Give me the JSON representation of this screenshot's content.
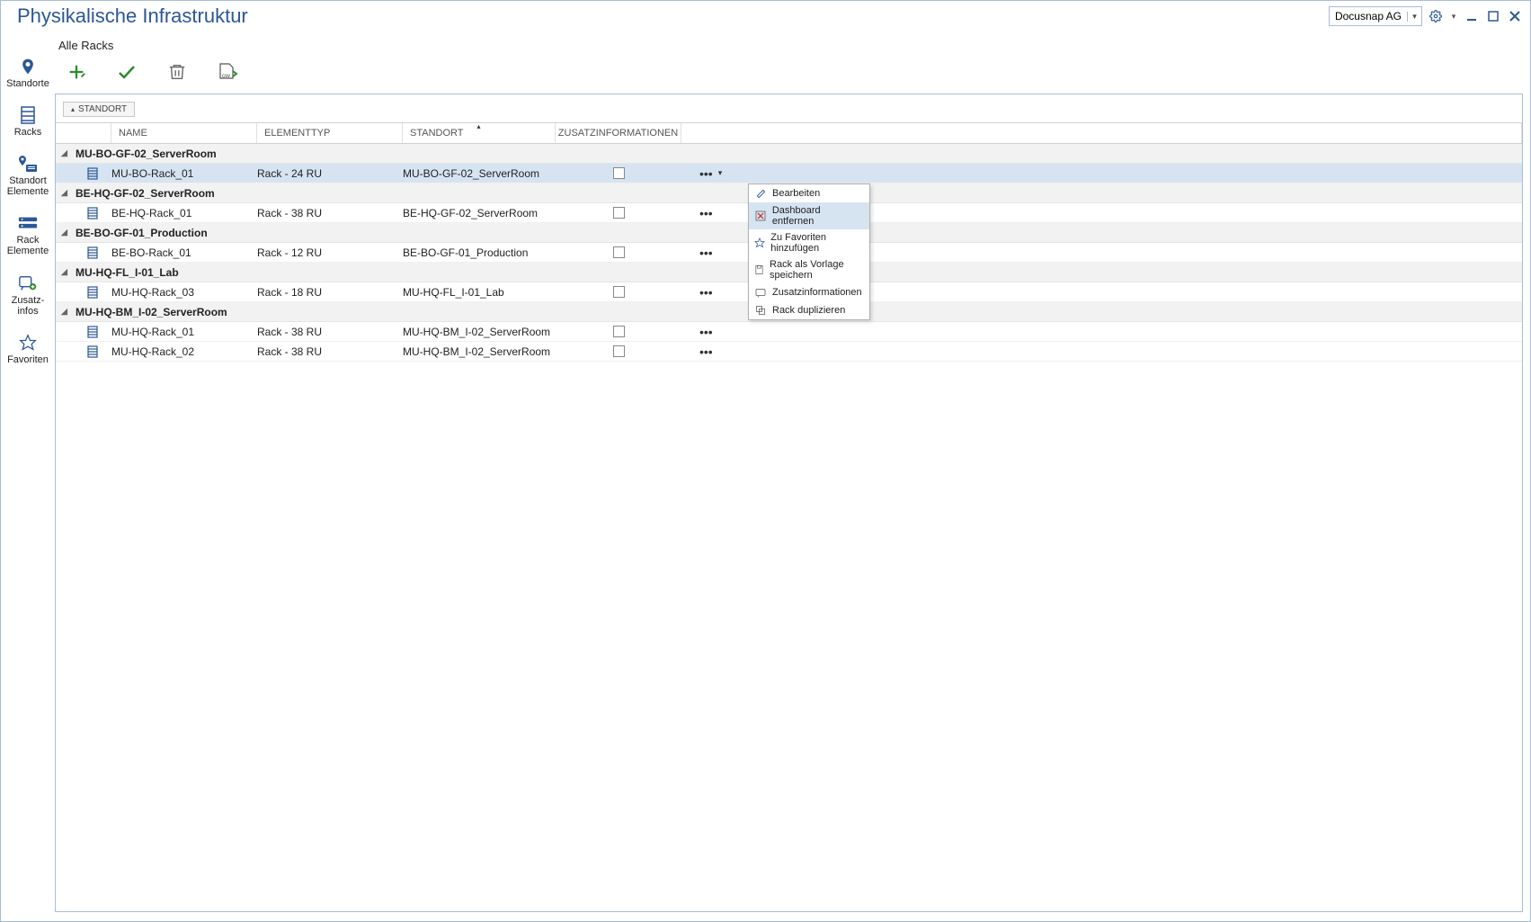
{
  "app_title": "Physikalische Infrastruktur",
  "org_name": "Docusnap AG",
  "sidebar": [
    {
      "id": "standorte",
      "label": "Standorte"
    },
    {
      "id": "racks",
      "label": "Racks"
    },
    {
      "id": "standort-elemente",
      "label": "Standort\nElemente"
    },
    {
      "id": "rack-elemente",
      "label": "Rack\nElemente"
    },
    {
      "id": "zusatz-infos",
      "label": "Zusatz-\ninfos"
    },
    {
      "id": "favoriten",
      "label": "Favoriten"
    }
  ],
  "section_title": "Alle Racks",
  "group_chip": "STANDORT",
  "columns": {
    "name": "NAME",
    "type": "ELEMENTTYP",
    "location": "STANDORT",
    "extra": "ZUSATZINFORMATIONEN"
  },
  "groups": [
    {
      "name": "MU-BO-GF-02_ServerRoom",
      "rows": [
        {
          "name": "MU-BO-Rack_01",
          "type": "Rack - 24 RU",
          "location": "MU-BO-GF-02_ServerRoom",
          "selected": true,
          "menu_open": true
        }
      ]
    },
    {
      "name": "BE-HQ-GF-02_ServerRoom",
      "rows": [
        {
          "name": "BE-HQ-Rack_01",
          "type": "Rack - 38 RU",
          "location": "BE-HQ-GF-02_ServerRoom"
        }
      ]
    },
    {
      "name": "BE-BO-GF-01_Production",
      "rows": [
        {
          "name": "BE-BO-Rack_01",
          "type": "Rack - 12 RU",
          "location": "BE-BO-GF-01_Production"
        }
      ]
    },
    {
      "name": "MU-HQ-FL_I-01_Lab",
      "rows": [
        {
          "name": "MU-HQ-Rack_03",
          "type": "Rack - 18 RU",
          "location": "MU-HQ-FL_I-01_Lab"
        }
      ]
    },
    {
      "name": "MU-HQ-BM_I-02_ServerRoom",
      "rows": [
        {
          "name": "MU-HQ-Rack_01",
          "type": "Rack - 38 RU",
          "location": "MU-HQ-BM_I-02_ServerRoom"
        },
        {
          "name": "MU-HQ-Rack_02",
          "type": "Rack - 38 RU",
          "location": "MU-HQ-BM_I-02_ServerRoom"
        }
      ]
    }
  ],
  "context_menu": [
    {
      "id": "edit",
      "label": "Bearbeiten"
    },
    {
      "id": "dashboard-remove",
      "label": "Dashboard entfernen",
      "highlight": true
    },
    {
      "id": "favorite-add",
      "label": "Zu Favoriten hinzufügen"
    },
    {
      "id": "save-template",
      "label": "Rack als Vorlage speichern"
    },
    {
      "id": "extra-info",
      "label": "Zusatzinformationen"
    },
    {
      "id": "duplicate",
      "label": "Rack duplizieren"
    }
  ]
}
